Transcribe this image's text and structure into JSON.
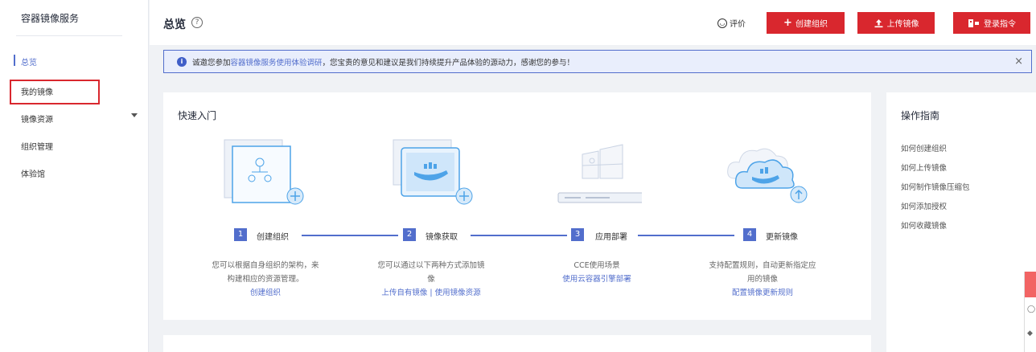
{
  "sidebar": {
    "title": "容器镜像服务",
    "items": [
      {
        "label": "总览"
      },
      {
        "label": "我的镜像"
      },
      {
        "label": "镜像资源"
      },
      {
        "label": "组织管理"
      },
      {
        "label": "体验馆"
      }
    ]
  },
  "header": {
    "title": "总览",
    "help_glyph": "?",
    "rate_label": "评价",
    "create_org_label": "创建组织",
    "upload_image_label": "上传镜像",
    "login_cmd_label": "登录指令"
  },
  "notice": {
    "prefix": "诚邀您参加",
    "link": "容器镜像服务使用体验调研",
    "suffix": "，您宝贵的意见和建议是我们持续提升产品体验的源动力，感谢您的参与！",
    "close_glyph": "×"
  },
  "quick_start": {
    "title": "快速入门",
    "steps": [
      {
        "num": "1",
        "label": "创建组织",
        "desc_line1": "您可以根据自身组织的架构，来",
        "desc_line2": "构建相应的资源管理。",
        "link": "创建组织"
      },
      {
        "num": "2",
        "label": "镜像获取",
        "desc_line1": "您可以通过以下两种方式添加镜",
        "desc_line2": "像",
        "link": "上传自有镜像 | 使用镜像资源"
      },
      {
        "num": "3",
        "label": "应用部署",
        "desc_line1": "CCE使用场景",
        "desc_line2": "",
        "link": "使用云容器引擎部署"
      },
      {
        "num": "4",
        "label": "更新镜像",
        "desc_line1": "支持配置规则，自动更新指定应",
        "desc_line2": "用的镜像",
        "link": "配置镜像更新规则"
      }
    ]
  },
  "guide": {
    "title": "操作指南",
    "items": [
      "如何创建组织",
      "如何上传镜像",
      "如何制作镜像压缩包",
      "如何添加授权",
      "如何收藏镜像"
    ]
  },
  "colors": {
    "accent": "#526ecc",
    "brand_red": "#d9272e",
    "notice_bg": "#e9eefc"
  }
}
